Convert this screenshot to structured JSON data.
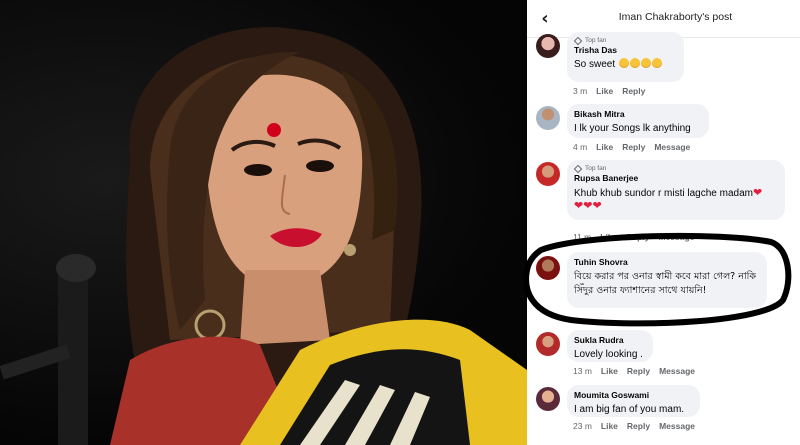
{
  "header": {
    "back_icon": "chevron-left-icon",
    "title": "Iman Chakraborty's post"
  },
  "comments": [
    {
      "author": "Trisha Das",
      "top_fan": true,
      "top_fan_label": "Top fan",
      "text": "So sweet",
      "emoji_count": 4,
      "time": "3 m",
      "like": "Like",
      "reply": "Reply",
      "message": ""
    },
    {
      "author": "Bikash Mitra",
      "top_fan": false,
      "text": "I lk your Songs lk anything",
      "time": "4 m",
      "like": "Like",
      "reply": "Reply",
      "message": "Message"
    },
    {
      "author": "Rupsa Banerjee",
      "top_fan": true,
      "top_fan_label": "Top fan",
      "text": "Khub khub sundor r misti lagche madam",
      "time": "11 m",
      "like": "Like",
      "reply": "Reply",
      "message": "Message"
    },
    {
      "author": "Tuhin Shovra",
      "top_fan": false,
      "text": "বিয়ে করার পর ওনার স্বামী কবে মারা গেল? নাকি সিঁদুর ওনার ফ্যাশানের সাথে যায়নি!",
      "time": "",
      "like": "",
      "reply": "",
      "message": ""
    },
    {
      "author": "Sukla Rudra",
      "top_fan": false,
      "text": "Lovely looking .",
      "time": "13 m",
      "like": "Like",
      "reply": "Reply",
      "message": "Message"
    },
    {
      "author": "Moumita Goswami",
      "top_fan": false,
      "text": "I am big fan of you mam.",
      "time": "23 m",
      "like": "Like",
      "reply": "Reply",
      "message": "Message"
    }
  ],
  "colors": {
    "highlight_ellipse": "#000000",
    "lipstick": "#c8102e",
    "bindi": "#d0021b",
    "saree_yellow": "#e8c020"
  },
  "icons": {
    "top_fan": "diamond-icon",
    "emoji": "smiling-face-icon",
    "heart": "heart-icon"
  }
}
